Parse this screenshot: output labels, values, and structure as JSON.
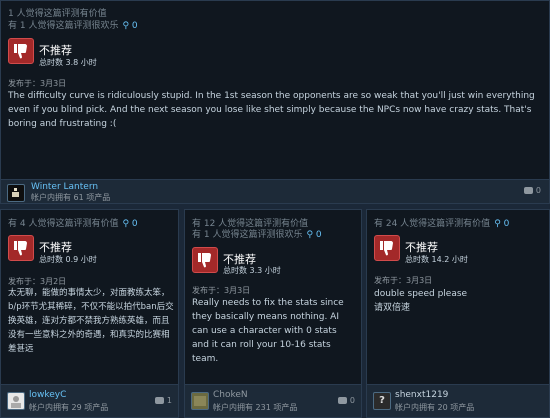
{
  "reviews": [
    {
      "helpful": "1 人觉得这篇评测有价值",
      "funny": "有 1 人觉得这篇评测很欢乐",
      "awards": "0",
      "verdict": "不推荐",
      "hours": "总时数 3.8 小时",
      "posted": "发布于：3月3日",
      "text": "The difficulty curve is ridiculously stupid. In the 1st season the opponents are so weak that you'll just win everything even if you blind pick. And the next season you lose like shet simply because the NPCs now have crazy stats. That's boring and frustrating :(",
      "user": "Winter Lantern",
      "products": "帐户内拥有 61 项产品",
      "comments": "0"
    },
    {
      "helpful": "有 4 人觉得这篇评测有价值",
      "awards": "0",
      "verdict": "不推荐",
      "hours": "总时数 0.9 小时",
      "posted": "发布于：3月2日",
      "text": "太无聊，能做的事情太少，对面教练太笨，b/p环节尤其稀碎，不仅不能以拍代ban后交换英雄，连对方都不禁我方熟练英雄，而且没有一些意料之外的奇遇，和真实的比赛相差甚远",
      "user": "lowkeyC",
      "products": "帐户内拥有 29 项产品",
      "comments": "1"
    },
    {
      "helpful": "有 12 人觉得这篇评测有价值",
      "funny": "有 1 人觉得这篇评测很欢乐",
      "awards": "0",
      "verdict": "不推荐",
      "hours": "总时数 3.3 小时",
      "posted": "发布于：3月3日",
      "text": "Really needs to fix the stats since they basically means nothing. AI can use a character with 0 stats and it can roll your 10-16 stats team.",
      "user": "ChokeN",
      "products": "帐户内拥有 231 项产品",
      "comments": "0"
    },
    {
      "helpful": "有 24 人觉得这篇评测有价值",
      "awards": "0",
      "verdict": "不推荐",
      "hours": "总时数 14.2 小时",
      "posted": "发布于：3月3日",
      "text": "double speed please\n请双倍速",
      "user": "shenxt1219",
      "products": "帐户内拥有 20 项产品",
      "comments": "0",
      "avatar_glyph": "?"
    }
  ],
  "icons": {
    "thumb": "thumbs-down-icon",
    "award": "award-icon",
    "comment": "comment-icon"
  },
  "colors": {
    "thumb_bg": "#a32929",
    "link": "#67c1f5",
    "page_bg": "#1b2838"
  }
}
